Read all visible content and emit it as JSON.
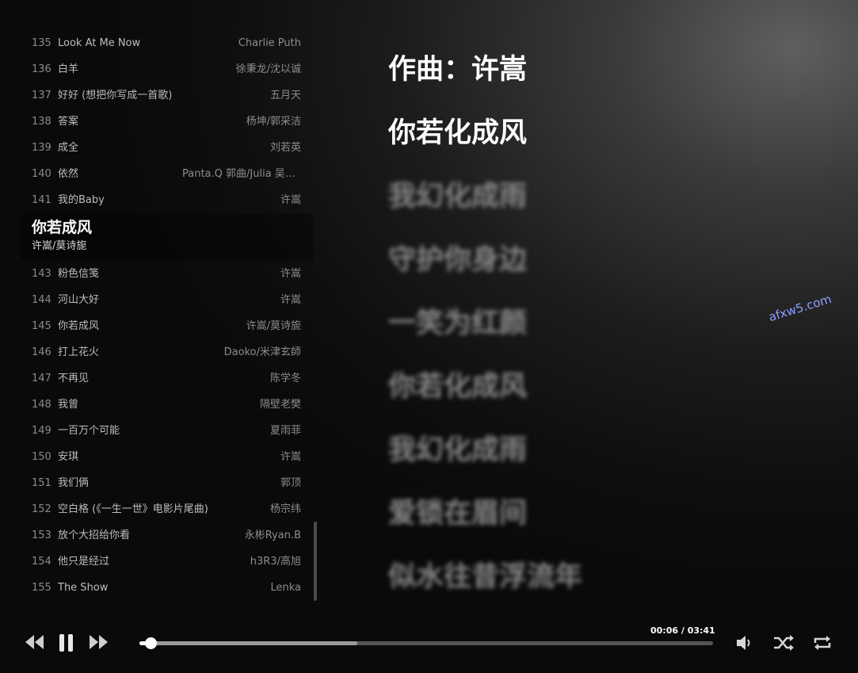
{
  "playlist": {
    "before": [
      {
        "num": "135",
        "title": "Look At Me Now",
        "artist": "Charlie Puth"
      },
      {
        "num": "136",
        "title": "白羊",
        "artist": "徐秉龙/沈以诚"
      },
      {
        "num": "137",
        "title": "好好 (想把你写成一首歌)",
        "artist": "五月天"
      },
      {
        "num": "138",
        "title": "答案",
        "artist": "杨坤/郭采洁"
      },
      {
        "num": "139",
        "title": "成全",
        "artist": "刘若英"
      },
      {
        "num": "140",
        "title": "依然",
        "artist": "Panta.Q 郭曲/Julia 吴詩…"
      },
      {
        "num": "141",
        "title": "我的Baby",
        "artist": "许嵩"
      }
    ],
    "current": {
      "title": "你若成风",
      "artist": "许嵩/莫诗旎"
    },
    "after": [
      {
        "num": "143",
        "title": "粉色信笺",
        "artist": "许嵩"
      },
      {
        "num": "144",
        "title": "河山大好",
        "artist": "许嵩"
      },
      {
        "num": "145",
        "title": "你若成风",
        "artist": "许嵩/莫诗旎"
      },
      {
        "num": "146",
        "title": "打上花火",
        "artist": "Daoko/米津玄師"
      },
      {
        "num": "147",
        "title": "不再见",
        "artist": "陈学冬"
      },
      {
        "num": "148",
        "title": "我曾",
        "artist": "隔壁老樊"
      },
      {
        "num": "149",
        "title": "一百万个可能",
        "artist": "夏雨菲"
      },
      {
        "num": "150",
        "title": "安琪",
        "artist": "许嵩"
      },
      {
        "num": "151",
        "title": "我们俩",
        "artist": "郭顶"
      },
      {
        "num": "152",
        "title": "空白格 (《一生一世》电影片尾曲)",
        "artist": "杨宗纬"
      },
      {
        "num": "153",
        "title": "放个大招给你看",
        "artist": "永彬Ryan.B"
      },
      {
        "num": "154",
        "title": "他只是经过",
        "artist": "h3R3/高旭"
      },
      {
        "num": "155",
        "title": "The Show",
        "artist": "Lenka"
      }
    ]
  },
  "lyrics": {
    "lines": [
      {
        "text": "作曲：许嵩",
        "active": true
      },
      {
        "text": "你若化成风",
        "active": true
      },
      {
        "text": "我幻化成雨",
        "active": false
      },
      {
        "text": "守护你身边",
        "active": false
      },
      {
        "text": "一笑为红颜",
        "active": false
      },
      {
        "text": "你若化成风",
        "active": false
      },
      {
        "text": "我幻化成雨",
        "active": false
      },
      {
        "text": "爱锁在眉间",
        "active": false
      },
      {
        "text": "似水往昔浮流年",
        "active": false
      }
    ]
  },
  "watermark": "afxw5.com",
  "player": {
    "time": "00:06 / 03:41",
    "progress": 0.019,
    "buffered": 0.38,
    "icons": {
      "previous": "previous-icon",
      "pause": "pause-icon",
      "next": "next-icon",
      "volume": "volume-icon",
      "shuffle": "shuffle-icon",
      "repeat": "repeat-icon"
    }
  },
  "colors": {
    "accent": "#ffffff",
    "inactive_lyric": "#8a8a8a",
    "watermark": "#8fa0ff"
  }
}
